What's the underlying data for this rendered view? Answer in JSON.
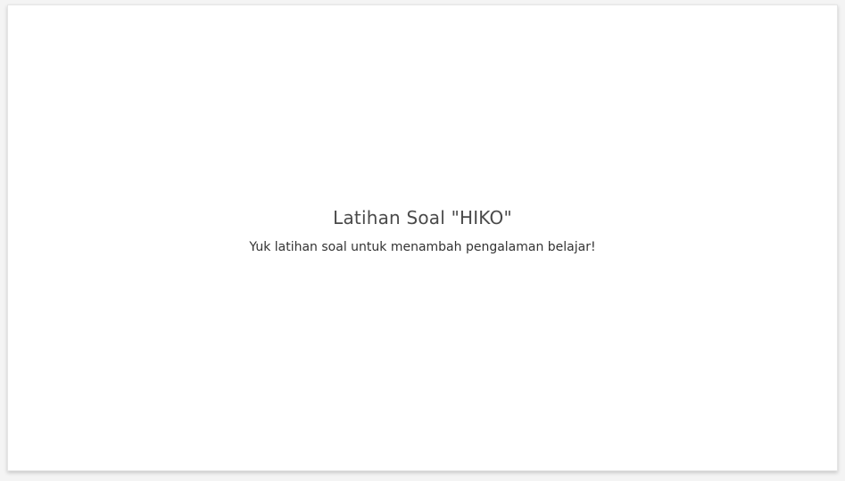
{
  "card": {
    "title": "Latihan Soal \"HIKO\"",
    "subtitle": "Yuk latihan soal untuk menambah pengalaman belajar!"
  }
}
